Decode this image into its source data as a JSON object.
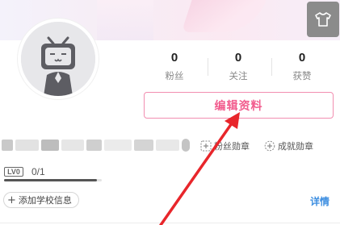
{
  "stats": [
    {
      "value": "0",
      "label": "粉丝"
    },
    {
      "value": "0",
      "label": "关注"
    },
    {
      "value": "0",
      "label": "获赞"
    }
  ],
  "edit_profile_label": "编辑资料",
  "medals": {
    "fan_medal_label": "粉丝勋章",
    "achievement_medal_label": "成就勋章"
  },
  "level": {
    "badge": "LV0",
    "exp_text": "0/1",
    "progress": 0.95
  },
  "add_school_label": "添加学校信息",
  "details_link_label": "详情",
  "colors": {
    "accent_pink": "#f25d8e",
    "link_blue": "#3c8ee0",
    "annotation_arrow": "#e8262b"
  },
  "icons": {
    "skin": "tshirt-icon",
    "avatar": "tv-mascot-avatar",
    "fan_medal": "add-medal-icon",
    "achievement_medal": "badge-icon"
  }
}
